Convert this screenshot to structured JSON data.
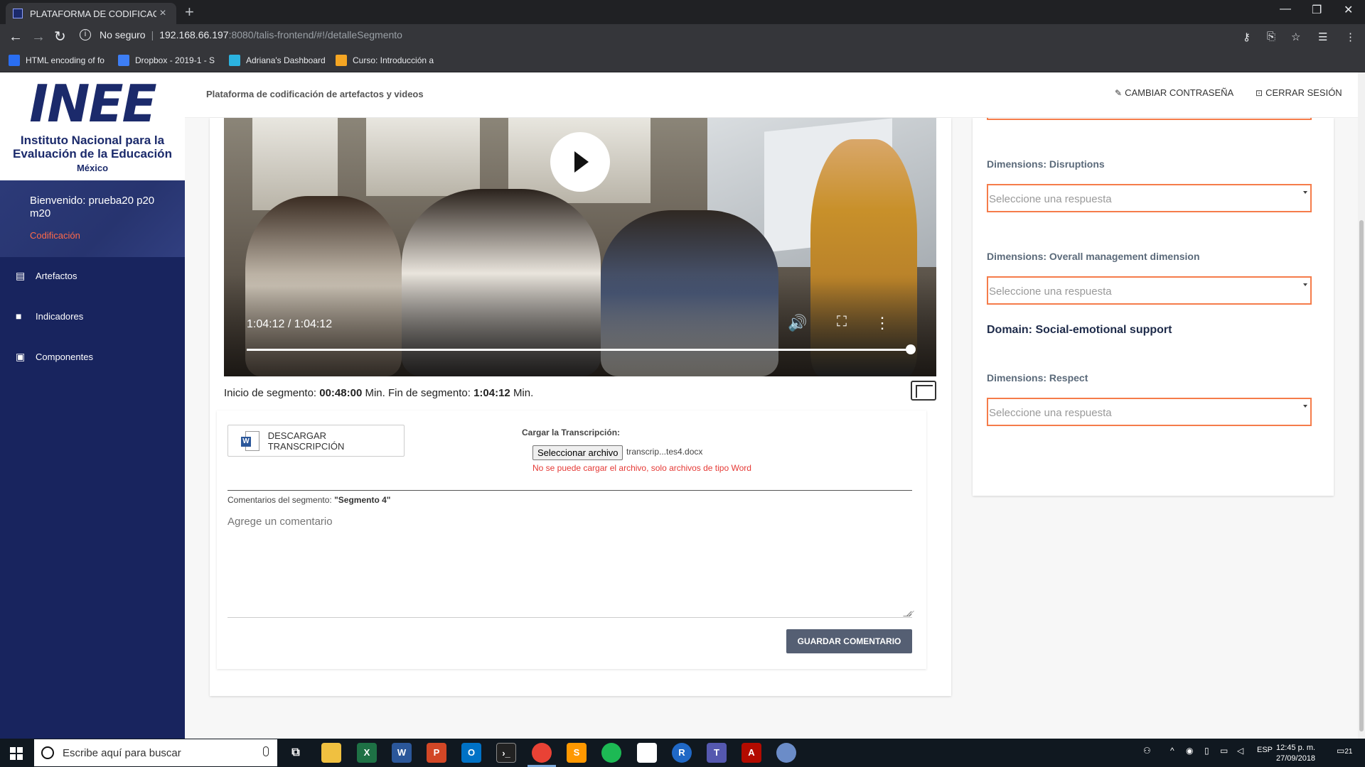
{
  "browser": {
    "tab_title": "PLATAFORMA DE CODIFICACIÓN",
    "security_label": "No seguro",
    "url_host": "192.168.66.197",
    "url_path": ":8080/talis-frontend/#!/detalleSegmento",
    "bookmarks": [
      {
        "label": "HTML encoding of fo",
        "icon": "text-icon",
        "color": "#2a6ef1"
      },
      {
        "label": "Dropbox - 2019-1 - S",
        "icon": "dropbox-icon",
        "color": "#3d7ef5"
      },
      {
        "label": "Adriana's Dashboard",
        "icon": "dashboard-icon",
        "color": "#2bb3e0"
      },
      {
        "label": "Curso: Introducción a",
        "icon": "course-icon",
        "color": "#f5a623"
      }
    ]
  },
  "sidebar": {
    "logo_mark": "INEE",
    "logo_line1": "Instituto Nacional para la",
    "logo_line2": "Evaluación de la Educación",
    "logo_country": "México",
    "welcome": "Bienvenido: prueba20 p20 m20",
    "role": "Codificación",
    "items": [
      {
        "label": "Artefactos",
        "icon": "document-icon"
      },
      {
        "label": "Indicadores",
        "icon": "video-camera-icon"
      },
      {
        "label": "Componentes",
        "icon": "library-icon"
      }
    ]
  },
  "header": {
    "title": "Plataforma de codificación de artefactos y videos",
    "change_password": "CAMBIAR CONTRASEÑA",
    "logout": "CERRAR SESIÓN"
  },
  "video": {
    "time": "1:04:12 / 1:04:12",
    "progress": 1.0
  },
  "segment": {
    "start_label": "Inicio de segmento:",
    "start_value": "00:48:00",
    "min1": "Min.",
    "end_label": "Fin de segmento:",
    "end_value": "1:04:12",
    "min2": "Min."
  },
  "transcript": {
    "download_label": "DESCARGAR TRANSCRIPCIÓN",
    "upload_label": "Cargar la Transcripción:",
    "file_button": "Seleccionar archivo",
    "file_name": "transcrip...tes4.docx",
    "error": "No se puede cargar el archivo, solo archivos de tipo Word"
  },
  "comments": {
    "label": "Comentarios del segmento:",
    "segment_name": "\"Segmento 4\"",
    "placeholder": "Agrege un comentario",
    "save_button": "GUARDAR COMENTARIO"
  },
  "questions": {
    "q1_label": "Dimensions: Disruptions",
    "q1_value": "Seleccione una respuesta",
    "q2_label": "Dimensions: Overall management dimension",
    "q2_value": "Seleccione una respuesta",
    "domain": "Domain: Social-emotional support",
    "q3_label": "Dimensions: Respect",
    "q3_value": "Seleccione una respuesta"
  },
  "taskbar": {
    "search_placeholder": "Escribe aquí para buscar",
    "language": "ESP",
    "time": "12:45 p. m.",
    "date": "27/09/2018",
    "notifications": "21"
  },
  "colors": {
    "sidebar_bg": "#18245e",
    "accent_orange": "#f57c4a",
    "error_red": "#e53935",
    "save_button_bg": "#555f73"
  }
}
